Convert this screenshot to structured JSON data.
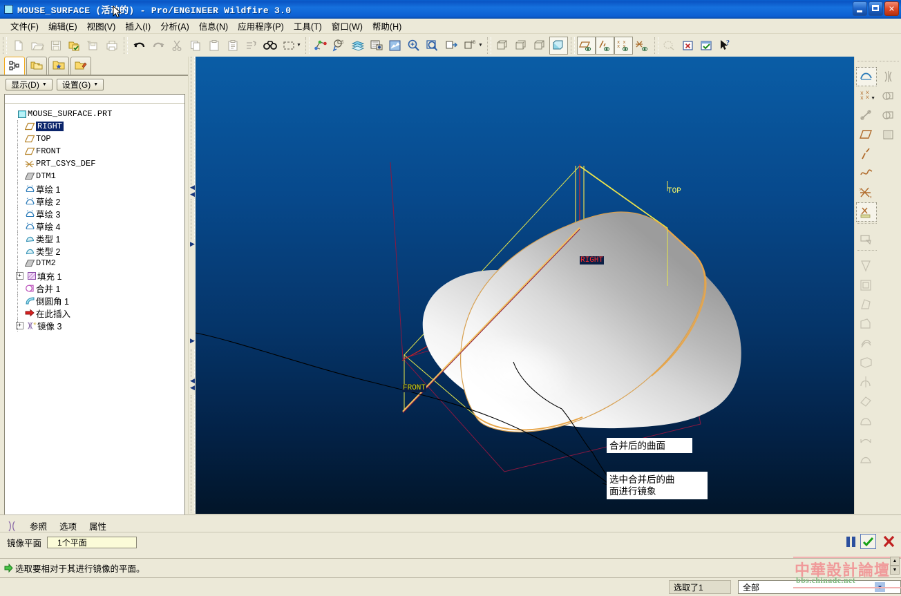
{
  "window": {
    "title": "MOUSE_SURFACE (活动的) - Pro/ENGINEER Wildfire 3.0",
    "minimize_label": "最小化",
    "maximize_label": "最大化",
    "close_label": "关闭"
  },
  "menubar": {
    "items": [
      {
        "label": "文件(F)",
        "name": "menu-file"
      },
      {
        "label": "编辑(E)",
        "name": "menu-edit"
      },
      {
        "label": "视图(V)",
        "name": "menu-view"
      },
      {
        "label": "插入(I)",
        "name": "menu-insert"
      },
      {
        "label": "分析(A)",
        "name": "menu-analysis"
      },
      {
        "label": "信息(N)",
        "name": "menu-info"
      },
      {
        "label": "应用程序(P)",
        "name": "menu-applications"
      },
      {
        "label": "工具(T)",
        "name": "menu-tools"
      },
      {
        "label": "窗口(W)",
        "name": "menu-window"
      },
      {
        "label": "帮助(H)",
        "name": "menu-help"
      }
    ]
  },
  "toolbar": {
    "items": [
      {
        "icon": "new-file-icon",
        "label": "新建",
        "enabled": false
      },
      {
        "icon": "open-file-icon",
        "label": "打开",
        "enabled": false
      },
      {
        "icon": "save-icon",
        "label": "保存",
        "enabled": false
      },
      {
        "icon": "save-active-icon",
        "label": "保存活动对象",
        "enabled": true
      },
      {
        "icon": "rename-icon",
        "label": "重命名",
        "enabled": false
      },
      {
        "icon": "print-icon",
        "label": "打印",
        "enabled": false
      },
      {
        "icon": "undo-icon",
        "label": "撤消",
        "enabled": true
      },
      {
        "icon": "redo-icon",
        "label": "重做",
        "enabled": false
      },
      {
        "icon": "cut-icon",
        "label": "剪切",
        "enabled": false
      },
      {
        "icon": "copy-icon",
        "label": "复制",
        "enabled": false
      },
      {
        "icon": "paste-icon",
        "label": "粘贴",
        "enabled": false
      },
      {
        "icon": "paste-special-icon",
        "label": "选择性粘贴",
        "enabled": false
      },
      {
        "icon": "regenerate-icon",
        "label": "重新生成",
        "enabled": false
      },
      {
        "icon": "find-icon",
        "label": "查找",
        "enabled": true
      },
      {
        "icon": "select-box-icon",
        "label": "选取框",
        "enabled": true
      },
      {
        "icon": "datum-point-icon",
        "label": "基准点",
        "enabled": true
      },
      {
        "icon": "analysis-icon",
        "label": "分析",
        "enabled": true
      },
      {
        "icon": "layers-icon",
        "label": "层",
        "enabled": true
      },
      {
        "icon": "appearance-icon",
        "label": "外观",
        "enabled": true
      },
      {
        "icon": "repaint-icon",
        "label": "重画",
        "enabled": true
      },
      {
        "icon": "zoom-in-icon",
        "label": "放大",
        "enabled": true
      },
      {
        "icon": "zoom-out-icon",
        "label": "缩小",
        "enabled": true
      },
      {
        "icon": "refit-icon",
        "label": "重新调整",
        "enabled": true
      },
      {
        "icon": "named-view-icon",
        "label": "已命名视图",
        "enabled": true
      },
      {
        "icon": "wireframe-icon",
        "label": "线框",
        "enabled": false
      },
      {
        "icon": "hidden-line-icon",
        "label": "隐藏线",
        "enabled": false
      },
      {
        "icon": "no-hidden-icon",
        "label": "无隐藏线",
        "enabled": false
      },
      {
        "icon": "shaded-icon",
        "label": "着色",
        "enabled": true,
        "active": true
      },
      {
        "icon": "datum-plane-toggle-icon",
        "label": "基准平面显示",
        "enabled": true,
        "active": true
      },
      {
        "icon": "datum-axis-toggle-icon",
        "label": "基准轴显示",
        "enabled": true,
        "active": true
      },
      {
        "icon": "datum-point-toggle-icon",
        "label": "基准点显示",
        "enabled": true,
        "active": true
      },
      {
        "icon": "csys-toggle-icon",
        "label": "坐标系显示",
        "enabled": true
      },
      {
        "icon": "annot-toggle-icon",
        "label": "注释显示",
        "enabled": false
      },
      {
        "icon": "delete-view-icon",
        "label": "删除",
        "enabled": true
      },
      {
        "icon": "checkmark-window-icon",
        "label": "确认",
        "enabled": true
      },
      {
        "icon": "help-pointer-icon",
        "label": "上下文帮助",
        "enabled": true
      }
    ]
  },
  "navigator": {
    "tabs": [
      {
        "name": "tab-model-tree",
        "icon": "model-tree-icon",
        "label": "模型树",
        "active": true
      },
      {
        "name": "tab-folder-browser",
        "icon": "folder-browser-icon",
        "label": "文件夹浏览器",
        "active": false
      },
      {
        "name": "tab-favorites",
        "icon": "favorites-icon",
        "label": "收藏夹",
        "active": false
      },
      {
        "name": "tab-connections",
        "icon": "connections-icon",
        "label": "连接",
        "active": false
      }
    ],
    "buttons": [
      {
        "name": "display-dropdown",
        "label": "显示(D)"
      },
      {
        "name": "settings-dropdown",
        "label": "设置(G)"
      }
    ],
    "tree": [
      {
        "label": "MOUSE_SURFACE.PRT",
        "icon": "part-icon",
        "depth": 0,
        "expander": "none",
        "selected": false,
        "script": "latin"
      },
      {
        "label": "RIGHT",
        "icon": "datum-plane-icon",
        "depth": 1,
        "expander": "none",
        "selected": true,
        "script": "latin"
      },
      {
        "label": "TOP",
        "icon": "datum-plane-icon",
        "depth": 1,
        "expander": "none",
        "selected": false,
        "script": "latin"
      },
      {
        "label": "FRONT",
        "icon": "datum-plane-icon",
        "depth": 1,
        "expander": "none",
        "selected": false,
        "script": "latin"
      },
      {
        "label": "PRT_CSYS_DEF",
        "icon": "csys-icon",
        "depth": 1,
        "expander": "none",
        "selected": false,
        "script": "latin"
      },
      {
        "label": "DTM1",
        "icon": "datum-plane-gray-icon",
        "depth": 1,
        "expander": "none",
        "selected": false,
        "script": "latin"
      },
      {
        "label": "草绘 1",
        "icon": "sketch-icon",
        "depth": 1,
        "expander": "none",
        "selected": false,
        "script": "cjk"
      },
      {
        "label": "草绘 2",
        "icon": "sketch-icon",
        "depth": 1,
        "expander": "none",
        "selected": false,
        "script": "cjk"
      },
      {
        "label": "草绘 3",
        "icon": "sketch-icon",
        "depth": 1,
        "expander": "none",
        "selected": false,
        "script": "cjk"
      },
      {
        "label": "草绘 4",
        "icon": "sketch-icon",
        "depth": 1,
        "expander": "none",
        "selected": false,
        "script": "cjk"
      },
      {
        "label": "类型 1",
        "icon": "boundary-blend-icon",
        "depth": 1,
        "expander": "none",
        "selected": false,
        "script": "cjk"
      },
      {
        "label": "类型 2",
        "icon": "boundary-blend-icon",
        "depth": 1,
        "expander": "none",
        "selected": false,
        "script": "cjk"
      },
      {
        "label": "DTM2",
        "icon": "datum-plane-gray-icon",
        "depth": 1,
        "expander": "none",
        "selected": false,
        "script": "latin"
      },
      {
        "label": "填充 1",
        "icon": "fill-icon",
        "depth": 1,
        "expander": "plus",
        "selected": false,
        "script": "cjk"
      },
      {
        "label": "合并 1",
        "icon": "merge-icon",
        "depth": 1,
        "expander": "none",
        "selected": false,
        "script": "cjk"
      },
      {
        "label": "倒圆角 1",
        "icon": "round-icon",
        "depth": 1,
        "expander": "none",
        "selected": false,
        "script": "cjk"
      },
      {
        "label": "在此插入",
        "icon": "insert-here-icon",
        "depth": 1,
        "expander": "none",
        "selected": false,
        "script": "cjk"
      },
      {
        "label": "镜像 3",
        "icon": "mirror-icon",
        "depth": 1,
        "expander": "plus",
        "selected": false,
        "script": "cjk"
      }
    ]
  },
  "viewport": {
    "background_top": "#0a5da6",
    "background_bottom": "#02152f",
    "datum_labels": [
      {
        "text": "TOP",
        "color": "#ffff66",
        "name": "datum-label-top"
      },
      {
        "text": "RIGHT",
        "color": "#ff3030",
        "name": "datum-label-right"
      },
      {
        "text": "FRONT",
        "color": "#d8d800",
        "name": "datum-label-front"
      }
    ],
    "annotations": [
      {
        "text": "合并后的曲面",
        "name": "annotation-merged-surface"
      },
      {
        "text": "选中合并后的曲\n面进行镜象",
        "name": "annotation-select-mirror"
      }
    ]
  },
  "right_toolbar": {
    "items": [
      {
        "icon": "sketch-tool-icon",
        "label": "草绘",
        "enabled": true,
        "active": true
      },
      {
        "icon": "mirror-tool-icon",
        "label": "镜像",
        "enabled": false
      },
      {
        "icon": "datum-point-tool-icon",
        "label": "基准点",
        "enabled": true,
        "caret": true
      },
      {
        "icon": "merge-tool-icon",
        "label": "合并",
        "enabled": false
      },
      {
        "icon": "datum-axis-tool-icon",
        "label": "基准轴",
        "enabled": false
      },
      {
        "icon": "trim-tool-icon",
        "label": "修剪",
        "enabled": false
      },
      {
        "icon": "datum-plane-tool-icon",
        "label": "基准平面",
        "enabled": true
      },
      {
        "icon": "fill-tool-icon",
        "label": "填充",
        "enabled": false
      },
      {
        "icon": "datum-line-tool-icon",
        "label": "基准线",
        "enabled": true
      },
      {
        "icon": "curve-tool-icon",
        "label": "基准曲线",
        "enabled": true
      },
      {
        "icon": "csys-tool-icon",
        "label": "坐标系",
        "enabled": true
      },
      {
        "icon": "analysis-feature-icon",
        "label": "分析特征",
        "enabled": true,
        "active": true
      },
      {
        "icon": "extrude-tool-icon",
        "label": "拉伸",
        "enabled": false
      },
      {
        "icon": "revolve-tool-icon",
        "label": "旋转",
        "enabled": false
      },
      {
        "icon": "sweep-tool-icon",
        "label": "扫描",
        "enabled": false
      },
      {
        "icon": "blend-tool-icon",
        "label": "混合",
        "enabled": false
      },
      {
        "icon": "hole-tool-icon",
        "label": "孔",
        "enabled": false
      },
      {
        "icon": "shell-tool-icon",
        "label": "壳",
        "enabled": false
      },
      {
        "icon": "round-tool-icon",
        "label": "倒圆角",
        "enabled": false
      },
      {
        "icon": "chamfer-tool-icon",
        "label": "倒角",
        "enabled": false
      },
      {
        "icon": "draft-tool-icon",
        "label": "拔模",
        "enabled": false
      },
      {
        "icon": "rib-tool-icon",
        "label": "筋",
        "enabled": false
      },
      {
        "icon": "pattern-tool-icon",
        "label": "阵列",
        "enabled": false
      },
      {
        "icon": "copy-geom-icon",
        "label": "复制几何",
        "enabled": false
      },
      {
        "icon": "surface-tool-icon",
        "label": "曲面",
        "enabled": false
      },
      {
        "icon": "boundary-blend-tool-icon",
        "label": "边界混合",
        "enabled": false
      }
    ]
  },
  "dashboard": {
    "feature_icon": "mirror-feature-icon",
    "tabs": [
      {
        "label": "参照",
        "name": "dash-tab-references"
      },
      {
        "label": "选项",
        "name": "dash-tab-options"
      },
      {
        "label": "属性",
        "name": "dash-tab-properties"
      }
    ],
    "field_label": "镜像平面",
    "field_value": "1个平面",
    "controls": [
      {
        "name": "pause-button",
        "icon": "pause-icon",
        "label": "暂停"
      },
      {
        "name": "accept-button",
        "icon": "checkmark-icon",
        "label": "完成"
      },
      {
        "name": "cancel-button",
        "icon": "cross-icon",
        "label": "取消"
      }
    ]
  },
  "message": {
    "icon": "green-arrow-icon",
    "text": "选取要相对于其进行镜像的平面。"
  },
  "statusbar": {
    "selection_count": "选取了1",
    "filter_value": "全部"
  },
  "watermark": {
    "cn": "中華設計論壇",
    "en": "bbs.chinade.net"
  }
}
